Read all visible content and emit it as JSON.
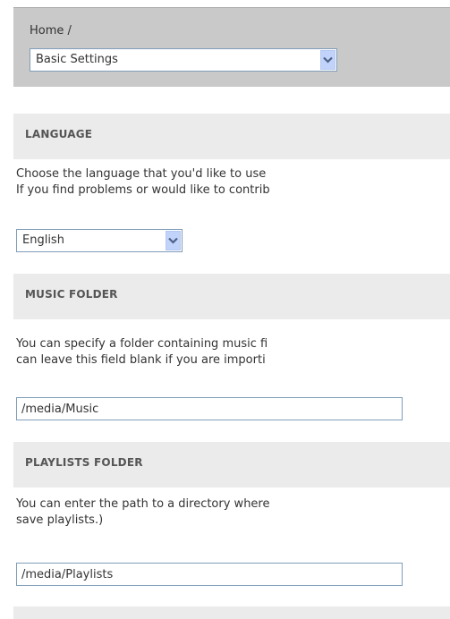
{
  "header": {
    "breadcrumb": "Home /",
    "page_select": {
      "value": "Basic Settings"
    }
  },
  "language": {
    "title": "LANGUAGE",
    "description": [
      "Choose the language that you'd like to use",
      "If you find problems or would like to contrib"
    ],
    "select_value": "English"
  },
  "music_folder": {
    "title": "MUSIC FOLDER",
    "description": [
      "You can specify a folder containing music fi",
      "can leave this field blank if you are importi"
    ],
    "value": "/media/Music"
  },
  "playlists_folder": {
    "title": "PLAYLISTS FOLDER",
    "description": [
      "You can enter the path to a directory where",
      "save playlists.)"
    ],
    "value": "/media/Playlists"
  },
  "icons": {
    "dropdown": "chevron-down-icon"
  },
  "colors": {
    "dropdown_button": "#c1d3fb",
    "dropdown_arrow": "#4d6185",
    "header_bg": "#c9c9c9",
    "section_bg": "#ebebeb"
  }
}
